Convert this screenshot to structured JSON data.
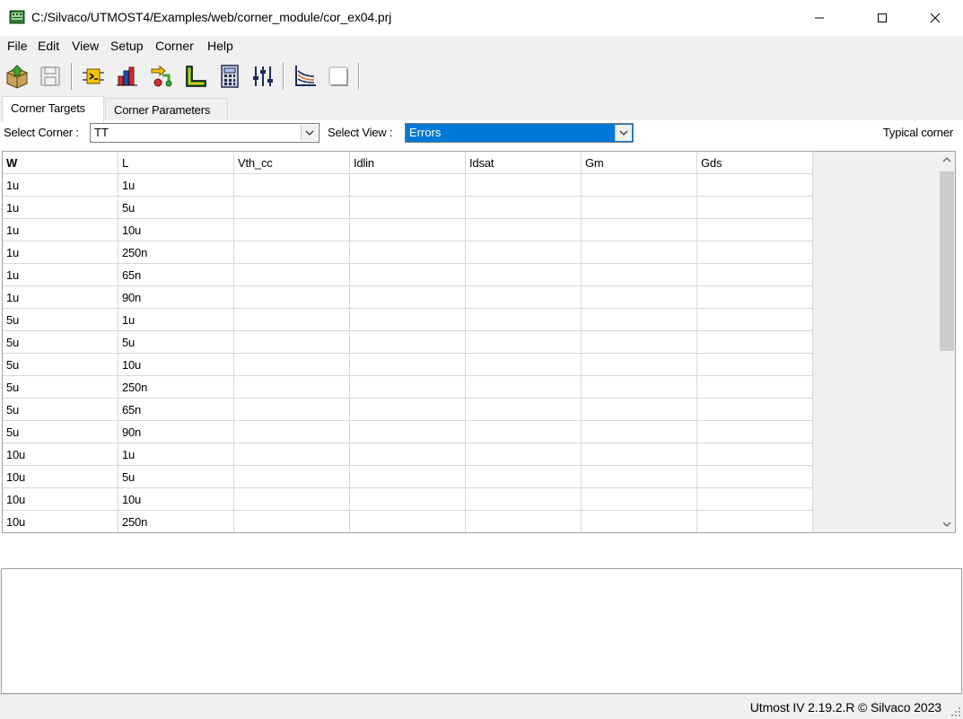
{
  "window": {
    "title": "C:/Silvaco/UTMOST4/Examples/web/corner_module/cor_ex04.prj",
    "controls": [
      "minimize",
      "maximize",
      "close"
    ]
  },
  "menu": [
    "File",
    "Edit",
    "View",
    "Setup",
    "Corner",
    "Help"
  ],
  "toolbar": {
    "icons": [
      "open-project-icon",
      "save-icon",
      "module-icon",
      "bar-chart-icon",
      "flow-icon",
      "corner-l-icon",
      "calculator-icon",
      "sliders-icon",
      "plot-curves-icon",
      "blank-page-icon"
    ]
  },
  "tabs": [
    {
      "label": "Corner Targets",
      "active": true
    },
    {
      "label": "Corner Parameters",
      "active": false
    }
  ],
  "filter": {
    "corner_label": "Select Corner :",
    "corner_value": "TT",
    "view_label": "Select View :",
    "view_value": "Errors",
    "right_text": "Typical corner"
  },
  "table": {
    "headers": [
      "W",
      "L",
      "Vth_cc",
      "Idlin",
      "Idsat",
      "Gm",
      "Gds"
    ],
    "rows": [
      [
        "1u",
        "1u",
        "",
        "",
        "",
        "",
        ""
      ],
      [
        "1u",
        "5u",
        "",
        "",
        "",
        "",
        ""
      ],
      [
        "1u",
        "10u",
        "",
        "",
        "",
        "",
        ""
      ],
      [
        "1u",
        "250n",
        "",
        "",
        "",
        "",
        ""
      ],
      [
        "1u",
        "65n",
        "",
        "",
        "",
        "",
        ""
      ],
      [
        "1u",
        "90n",
        "",
        "",
        "",
        "",
        ""
      ],
      [
        "5u",
        "1u",
        "",
        "",
        "",
        "",
        ""
      ],
      [
        "5u",
        "5u",
        "",
        "",
        "",
        "",
        ""
      ],
      [
        "5u",
        "10u",
        "",
        "",
        "",
        "",
        ""
      ],
      [
        "5u",
        "250n",
        "",
        "",
        "",
        "",
        ""
      ],
      [
        "5u",
        "65n",
        "",
        "",
        "",
        "",
        ""
      ],
      [
        "5u",
        "90n",
        "",
        "",
        "",
        "",
        ""
      ],
      [
        "10u",
        "1u",
        "",
        "",
        "",
        "",
        ""
      ],
      [
        "10u",
        "5u",
        "",
        "",
        "",
        "",
        ""
      ],
      [
        "10u",
        "10u",
        "",
        "",
        "",
        "",
        ""
      ],
      [
        "10u",
        "250n",
        "",
        "",
        "",
        "",
        ""
      ]
    ]
  },
  "status": "Utmost IV 2.19.2.R © Silvaco 2023",
  "colors": {
    "selection": "#0078d7",
    "chrome": "#f0f0f0",
    "grid_line": "#d8d8d8"
  }
}
